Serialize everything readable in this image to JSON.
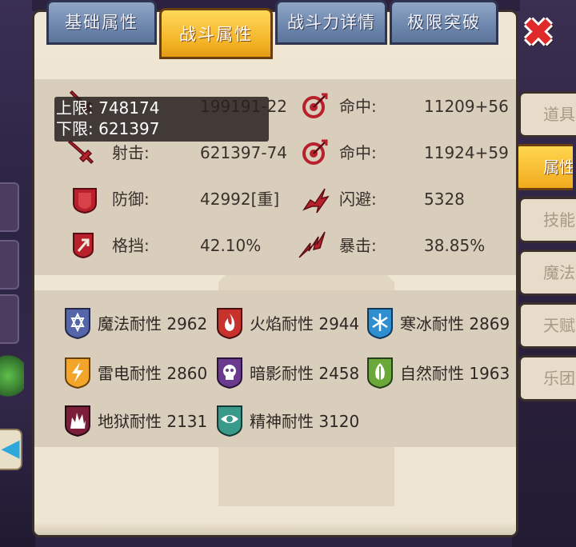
{
  "tabs": [
    {
      "label": "基础属性",
      "active": false
    },
    {
      "label": "战斗属性",
      "active": true
    },
    {
      "label": "战斗力详情",
      "active": false
    },
    {
      "label": "极限突破",
      "active": false
    }
  ],
  "tooltip": {
    "upper": "上限: 748174",
    "lower": "下限: 621397"
  },
  "stats": {
    "row1": {
      "left_label": "",
      "left_value": "199191-22",
      "right_label": "命中:",
      "right_value": "11209+56"
    },
    "row2": {
      "left_label": "射击:",
      "left_value": "621397-74",
      "right_label": "命中:",
      "right_value": "11924+59"
    },
    "row3": {
      "left_label": "防御:",
      "left_value": "42992[重]",
      "right_label": "闪避:",
      "right_value": "5328"
    },
    "row4": {
      "left_label": "格挡:",
      "left_value": "42.10%",
      "right_label": "暴击:",
      "right_value": "38.85%"
    }
  },
  "resistances": [
    {
      "label": "魔法耐性 2962",
      "icon": "magic-resist-icon",
      "color": "#5466a8"
    },
    {
      "label": "火焰耐性 2944",
      "icon": "fire-resist-icon",
      "color": "#c8322c"
    },
    {
      "label": "寒冰耐性 2869",
      "icon": "ice-resist-icon",
      "color": "#2e8fd0"
    },
    {
      "label": "雷电耐性 2860",
      "icon": "thunder-resist-icon",
      "color": "#f2a52a"
    },
    {
      "label": "暗影耐性 2458",
      "icon": "shadow-resist-icon",
      "color": "#6a3a8e"
    },
    {
      "label": "自然耐性 1963",
      "icon": "nature-resist-icon",
      "color": "#6aa83a"
    },
    {
      "label": "地狱耐性 2131",
      "icon": "hell-resist-icon",
      "color": "#7a1e3a"
    },
    {
      "label": "精神耐性 3120",
      "icon": "spirit-resist-icon",
      "color": "#3a9a8a"
    }
  ],
  "side_tabs": [
    {
      "label": "道具",
      "active": false
    },
    {
      "label": "属性",
      "active": true
    },
    {
      "label": "技能",
      "active": false
    },
    {
      "label": "魔法",
      "active": false
    },
    {
      "label": "天赋",
      "active": false
    },
    {
      "label": "乐团",
      "active": false
    }
  ],
  "colors": {
    "active_tab": "#f3b326",
    "inactive_tab": "#6d86ac",
    "stat_icon": "#b8202c"
  }
}
